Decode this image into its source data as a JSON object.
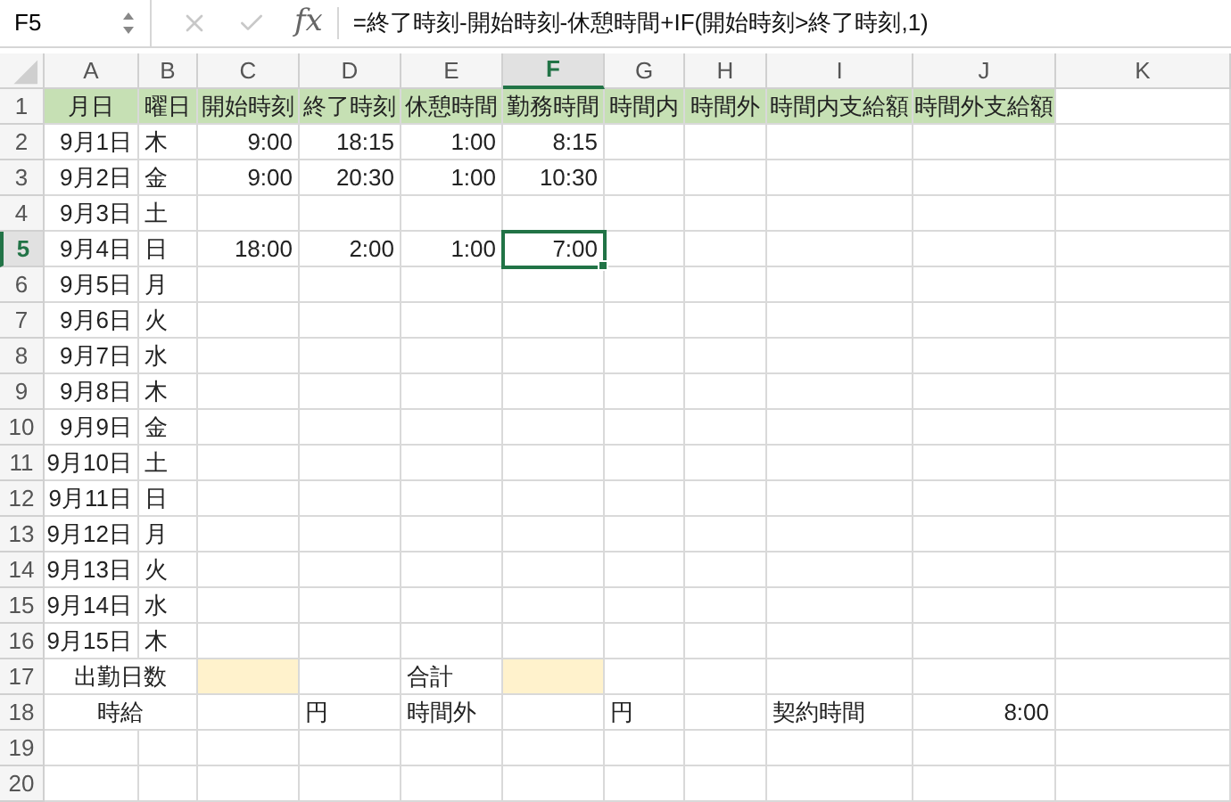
{
  "name_box": "F5",
  "function_label": "fx",
  "formula": "=終了時刻-開始時刻-休憩時間+IF(開始時刻>終了時刻,1)",
  "column_headers": [
    {
      "label": "A",
      "selected": false
    },
    {
      "label": "B",
      "selected": false
    },
    {
      "label": "C",
      "selected": false
    },
    {
      "label": "D",
      "selected": false
    },
    {
      "label": "E",
      "selected": false
    },
    {
      "label": "F",
      "selected": true
    },
    {
      "label": "G",
      "selected": false
    },
    {
      "label": "H",
      "selected": false
    },
    {
      "label": "I",
      "selected": false
    },
    {
      "label": "J",
      "selected": false
    },
    {
      "label": "K",
      "selected": false
    }
  ],
  "rows": [
    {
      "number": "1",
      "selected": false,
      "cells": [
        {
          "kind": "heading",
          "text": "月日",
          "color": "#c6e0b4"
        },
        {
          "kind": "heading",
          "text": "曜日",
          "color": "#c6e0b4"
        },
        {
          "kind": "heading",
          "text": "開始時刻",
          "color": "#c6e0b4"
        },
        {
          "kind": "heading",
          "text": "終了時刻",
          "color": "#c6e0b4"
        },
        {
          "kind": "heading",
          "text": "休憩時間",
          "color": "#c6e0b4"
        },
        {
          "kind": "heading",
          "text": "勤務時間",
          "color": "#c6e0b4"
        },
        {
          "kind": "heading",
          "text": "時間内",
          "color": "#c6e0b4"
        },
        {
          "kind": "heading",
          "text": "時間外",
          "color": "#c6e0b4"
        },
        {
          "kind": "heading",
          "text": "時間内支給額",
          "color": "#c6e0b4"
        },
        {
          "kind": "heading",
          "text": "時間外支給額",
          "color": "#c6e0b4"
        }
      ]
    },
    {
      "number": "2",
      "selected": false,
      "cells": [
        {
          "kind": "number",
          "text": "9月1日"
        },
        {
          "kind": "text",
          "text": "木"
        },
        {
          "kind": "number",
          "text": "9:00"
        },
        {
          "kind": "number",
          "text": "18:15"
        },
        {
          "kind": "number",
          "text": "1:00"
        },
        {
          "kind": "number",
          "text": "8:15"
        }
      ]
    },
    {
      "number": "3",
      "selected": false,
      "cells": [
        {
          "kind": "number",
          "text": "9月2日"
        },
        {
          "kind": "text",
          "text": "金"
        },
        {
          "kind": "number",
          "text": "9:00"
        },
        {
          "kind": "number",
          "text": "20:30"
        },
        {
          "kind": "number",
          "text": "1:00"
        },
        {
          "kind": "number",
          "text": "10:30"
        }
      ]
    },
    {
      "number": "4",
      "selected": false,
      "cells": [
        {
          "kind": "number",
          "text": "9月3日"
        },
        {
          "kind": "text",
          "text": "土"
        }
      ]
    },
    {
      "number": "5",
      "selected": true,
      "cells": [
        {
          "kind": "number",
          "text": "9月4日"
        },
        {
          "kind": "text",
          "text": "日"
        },
        {
          "kind": "number",
          "text": "18:00"
        },
        {
          "kind": "number",
          "text": "2:00"
        },
        {
          "kind": "number",
          "text": "1:00"
        },
        {
          "kind": "number",
          "text": "7:00",
          "active": true
        }
      ]
    },
    {
      "number": "6",
      "selected": false,
      "cells": [
        {
          "kind": "number",
          "text": "9月5日"
        },
        {
          "kind": "text",
          "text": "月"
        }
      ]
    },
    {
      "number": "7",
      "selected": false,
      "cells": [
        {
          "kind": "number",
          "text": "9月6日"
        },
        {
          "kind": "text",
          "text": "火"
        }
      ]
    },
    {
      "number": "8",
      "selected": false,
      "cells": [
        {
          "kind": "number",
          "text": "9月7日"
        },
        {
          "kind": "text",
          "text": "水"
        }
      ]
    },
    {
      "number": "9",
      "selected": false,
      "cells": [
        {
          "kind": "number",
          "text": "9月8日"
        },
        {
          "kind": "text",
          "text": "木"
        }
      ]
    },
    {
      "number": "10",
      "selected": false,
      "cells": [
        {
          "kind": "number",
          "text": "9月9日"
        },
        {
          "kind": "text",
          "text": "金"
        }
      ]
    },
    {
      "number": "11",
      "selected": false,
      "cells": [
        {
          "kind": "number",
          "text": "9月10日"
        },
        {
          "kind": "text",
          "text": "土"
        }
      ]
    },
    {
      "number": "12",
      "selected": false,
      "cells": [
        {
          "kind": "number",
          "text": "9月11日"
        },
        {
          "kind": "text",
          "text": "日"
        }
      ]
    },
    {
      "number": "13",
      "selected": false,
      "cells": [
        {
          "kind": "number",
          "text": "9月12日"
        },
        {
          "kind": "text",
          "text": "月"
        }
      ]
    },
    {
      "number": "14",
      "selected": false,
      "cells": [
        {
          "kind": "number",
          "text": "9月13日"
        },
        {
          "kind": "text",
          "text": "火"
        }
      ]
    },
    {
      "number": "15",
      "selected": false,
      "cells": [
        {
          "kind": "number",
          "text": "9月14日"
        },
        {
          "kind": "text",
          "text": "水"
        }
      ]
    },
    {
      "number": "16",
      "selected": false,
      "cells": [
        {
          "kind": "number",
          "text": "9月15日"
        },
        {
          "kind": "text",
          "text": "木"
        }
      ]
    },
    {
      "number": "17",
      "selected": false,
      "cells": [
        {
          "kind": "merged",
          "text": "出勤日数"
        },
        {
          "kind": "blank",
          "color": "#fff2cc"
        },
        {
          "kind": "blank"
        },
        {
          "kind": "text",
          "text": "合計"
        },
        {
          "kind": "blank",
          "color": "#fff2cc"
        }
      ]
    },
    {
      "number": "18",
      "selected": false,
      "cells": [
        {
          "kind": "merged",
          "text": "時給"
        },
        {
          "kind": "blank"
        },
        {
          "kind": "text",
          "text": "円"
        },
        {
          "kind": "text",
          "text": "時間外"
        },
        {
          "kind": "blank"
        },
        {
          "kind": "text",
          "text": "円"
        },
        {
          "kind": "blank"
        },
        {
          "kind": "text",
          "text": "契約時間"
        },
        {
          "kind": "number",
          "text": "8:00"
        }
      ]
    },
    {
      "number": "19",
      "selected": false
    },
    {
      "number": "20",
      "selected": false
    }
  ]
}
